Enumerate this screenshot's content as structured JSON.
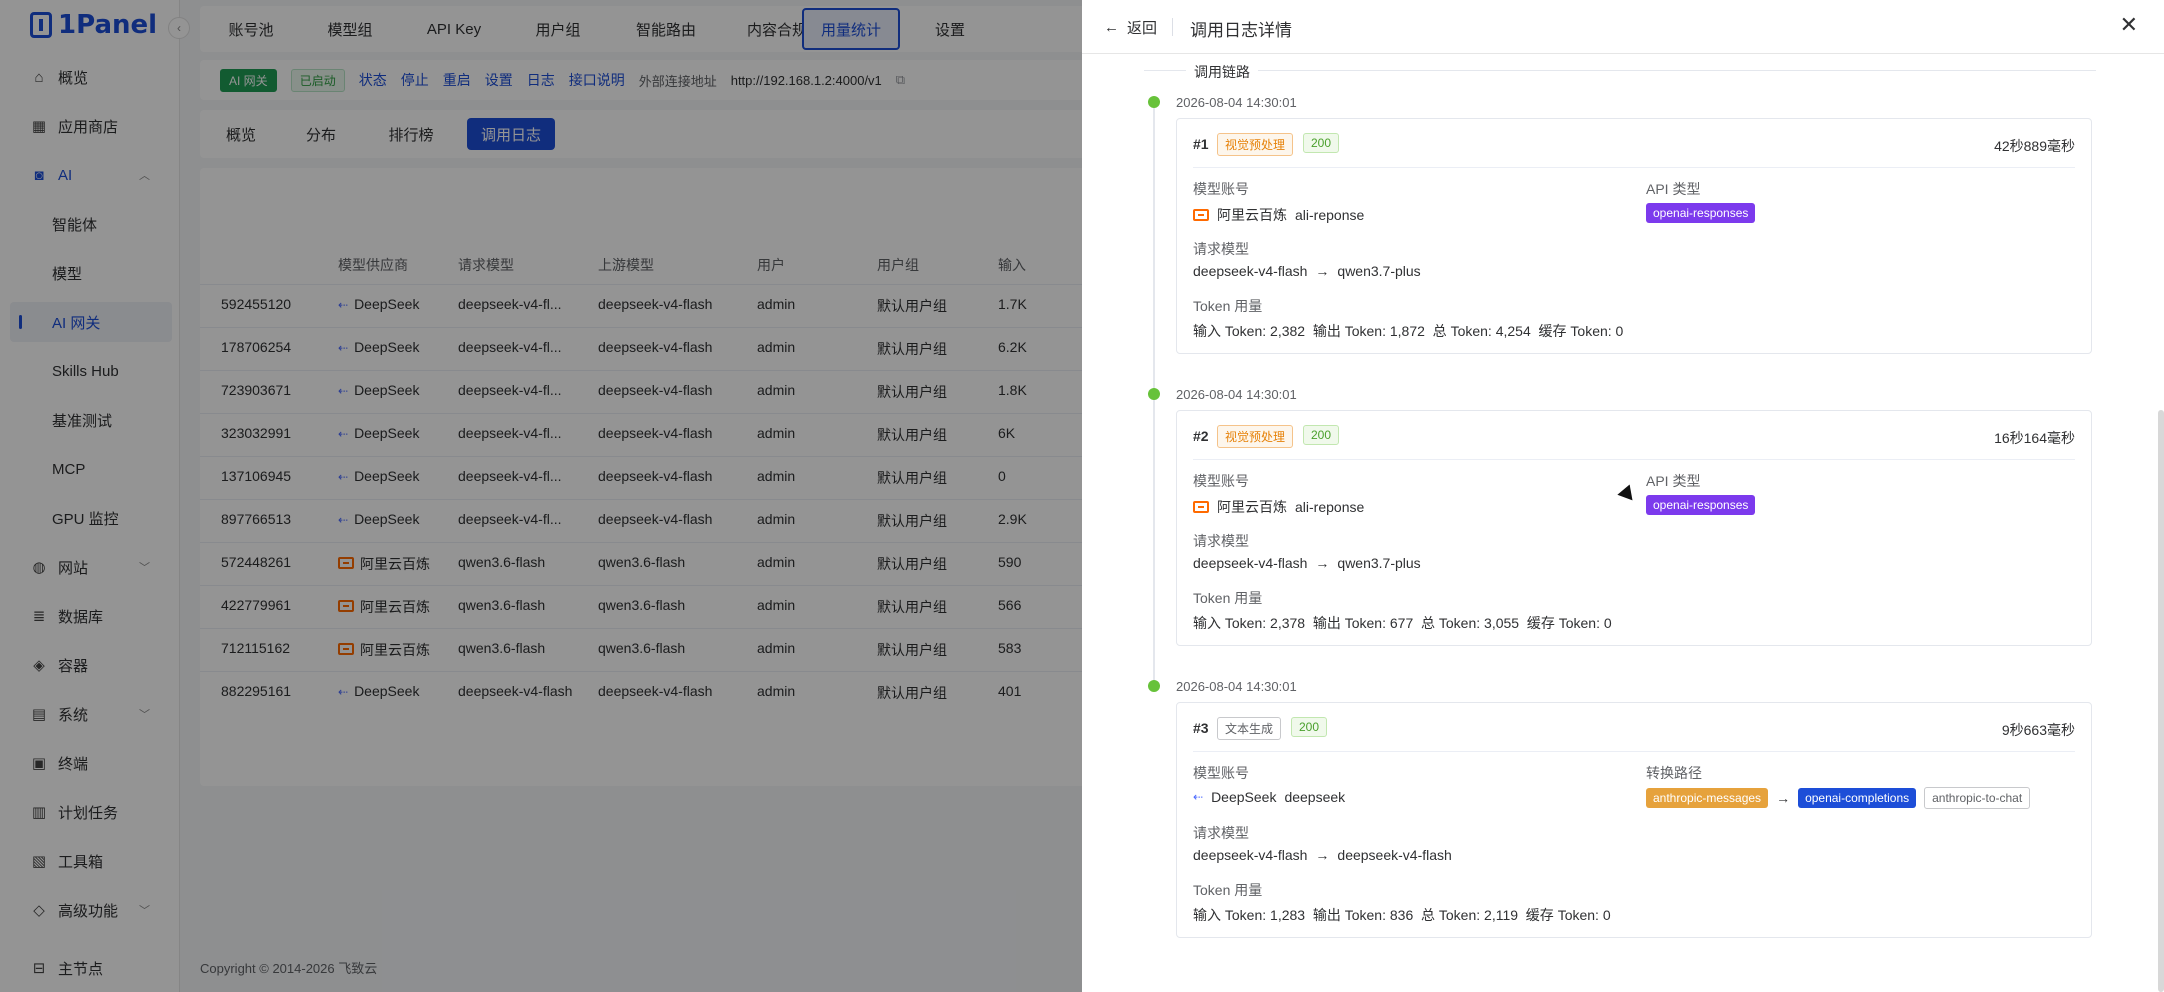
{
  "app": {
    "logo_text": "1Panel"
  },
  "sidebar": {
    "items": [
      {
        "label": "概览",
        "icon": "home-icon"
      },
      {
        "label": "应用商店",
        "icon": "grid-icon"
      },
      {
        "label": "AI",
        "icon": "robot-icon"
      },
      {
        "label": "智能体"
      },
      {
        "label": "模型"
      },
      {
        "label": "AI 网关"
      },
      {
        "label": "Skills Hub"
      },
      {
        "label": "基准测试"
      },
      {
        "label": "MCP"
      },
      {
        "label": "GPU 监控"
      },
      {
        "label": "网站",
        "icon": "globe-icon"
      },
      {
        "label": "数据库",
        "icon": "database-icon"
      },
      {
        "label": "容器",
        "icon": "container-icon"
      },
      {
        "label": "系统",
        "icon": "system-icon"
      },
      {
        "label": "终端",
        "icon": "terminal-icon"
      },
      {
        "label": "计划任务",
        "icon": "calendar-icon"
      },
      {
        "label": "工具箱",
        "icon": "toolbox-icon"
      },
      {
        "label": "高级功能",
        "icon": "diamond-icon"
      },
      {
        "label": "主节点",
        "icon": "node-icon"
      }
    ]
  },
  "top_tabs": [
    "账号池",
    "模型组",
    "API Key",
    "用户组",
    "智能路由",
    "内容合规",
    "用量统计",
    "设置"
  ],
  "subbar": {
    "gateway_tag": "AI 网关",
    "status_tag": "已启动",
    "actions": [
      "状态",
      "停止",
      "重启",
      "设置",
      "日志",
      "接口说明"
    ],
    "external_label": "外部连接地址",
    "external_url": "http://192.168.1.2:4000/v1"
  },
  "view_tabs": [
    "概览",
    "分布",
    "排行榜",
    "调用日志"
  ],
  "table": {
    "columns": [
      "模型供应商",
      "请求模型",
      "上游模型",
      "用户",
      "用户组",
      "输入"
    ],
    "rows": [
      [
        "592455120",
        "DeepSeek",
        "deepseek-v4-fl...",
        "deepseek-v4-flash",
        "admin",
        "默认用户组",
        "1.7K"
      ],
      [
        "178706254",
        "DeepSeek",
        "deepseek-v4-fl...",
        "deepseek-v4-flash",
        "admin",
        "默认用户组",
        "6.2K"
      ],
      [
        "723903671",
        "DeepSeek",
        "deepseek-v4-fl...",
        "deepseek-v4-flash",
        "admin",
        "默认用户组",
        "1.8K"
      ],
      [
        "323032991",
        "DeepSeek",
        "deepseek-v4-fl...",
        "deepseek-v4-flash",
        "admin",
        "默认用户组",
        "6K"
      ],
      [
        "137106945",
        "DeepSeek",
        "deepseek-v4-fl...",
        "deepseek-v4-flash",
        "admin",
        "默认用户组",
        "0"
      ],
      [
        "897766513",
        "DeepSeek",
        "deepseek-v4-fl...",
        "deepseek-v4-flash",
        "admin",
        "默认用户组",
        "2.9K"
      ],
      [
        "572448261",
        "阿里云百炼",
        "qwen3.6-flash",
        "qwen3.6-flash",
        "admin",
        "默认用户组",
        "590"
      ],
      [
        "422779961",
        "阿里云百炼",
        "qwen3.6-flash",
        "qwen3.6-flash",
        "admin",
        "默认用户组",
        "566"
      ],
      [
        "712115162",
        "阿里云百炼",
        "qwen3.6-flash",
        "qwen3.6-flash",
        "admin",
        "默认用户组",
        "583"
      ],
      [
        "882295161",
        "DeepSeek",
        "deepseek-v4-flash",
        "deepseek-v4-flash",
        "admin",
        "默认用户组",
        "401"
      ]
    ]
  },
  "footer": "Copyright © 2014-2026 飞致云",
  "drawer": {
    "back_label": "返回",
    "title": "调用日志详情",
    "chain_label": "调用链路",
    "labels": {
      "account": "模型账号",
      "api_type": "API 类型",
      "convert_path": "转换路径",
      "request_model": "请求模型",
      "token_usage": "Token 用量"
    },
    "calls": [
      {
        "time": "2026-08-04 14:30:01",
        "index": "#1",
        "type_tag": "视觉预处理",
        "status": "200",
        "duration": "42秒889毫秒",
        "provider": "阿里云百炼",
        "account": "ali-reponse",
        "api_type": "openai-responses",
        "req_model": "deepseek-v4-flash",
        "up_model": "qwen3.7-plus",
        "tokens": "输入 Token: 2,382  输出 Token: 1,872  总 Token: 4,254  缓存 Token: 0"
      },
      {
        "time": "2026-08-04 14:30:01",
        "index": "#2",
        "type_tag": "视觉预处理",
        "status": "200",
        "duration": "16秒164毫秒",
        "provider": "阿里云百炼",
        "account": "ali-reponse",
        "api_type": "openai-responses",
        "req_model": "deepseek-v4-flash",
        "up_model": "qwen3.7-plus",
        "tokens": "输入 Token: 2,378  输出 Token: 677  总 Token: 3,055  缓存 Token: 0"
      },
      {
        "time": "2026-08-04 14:30:01",
        "index": "#3",
        "type_tag": "文本生成",
        "status": "200",
        "duration": "9秒663毫秒",
        "provider": "DeepSeek",
        "account": "deepseek",
        "path": [
          "anthropic-messages",
          "openai-completions",
          "anthropic-to-chat"
        ],
        "req_model": "deepseek-v4-flash",
        "up_model": "deepseek-v4-flash",
        "tokens": "输入 Token: 1,283  输出 Token: 836  总 Token: 2,119  缓存 Token: 0"
      }
    ]
  }
}
